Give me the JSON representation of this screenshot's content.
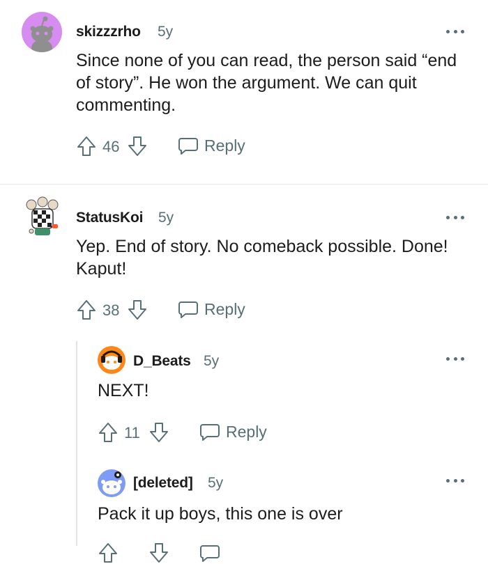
{
  "comments": [
    {
      "author": "skizzzrho",
      "age": "5y",
      "text": "Since none of you can read, the person said “end of story”. He won the argument. We can quit commenting.",
      "score": "46",
      "reply_label": "Reply",
      "avatar_icon": "snoo-avatar-purple",
      "avatar_bg": "#d68cf0"
    },
    {
      "author": "StatusKoi",
      "age": "5y",
      "text": "Yep. End of story. No comeback possible. Done! Kaput!",
      "score": "38",
      "reply_label": "Reply",
      "avatar_icon": "custom-snoo-avatar"
    },
    {
      "author": "D_Beats",
      "age": "5y",
      "text": "NEXT!",
      "score": "11",
      "reply_label": "Reply",
      "avatar_icon": "snoo-avatar-orange",
      "avatar_bg": "#ff8717"
    },
    {
      "author": "[deleted]",
      "age": "5y",
      "text": "Pack it up boys, this one is over",
      "avatar_icon": "snoo-avatar-blue",
      "avatar_bg": "#7e9cf5"
    }
  ],
  "colors": {
    "meta_gray": "#576f76",
    "text": "#1c1c1c",
    "divider": "#e5e7e8"
  }
}
